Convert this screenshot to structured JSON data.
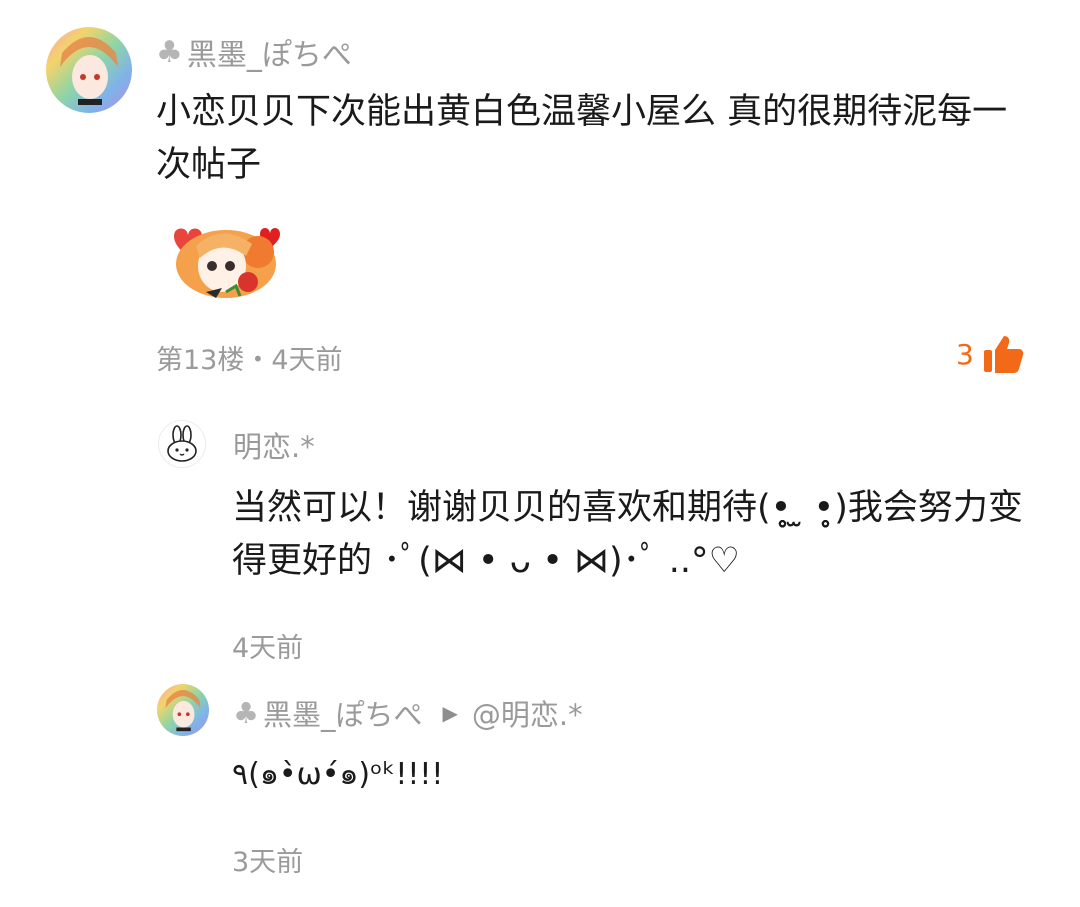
{
  "accent_color": "#f26a17",
  "comments": [
    {
      "username": "黑墨_ぽちぺ",
      "username_icon": "club-icon",
      "content": "小恋贝贝下次能出黄白色温馨小屋么 真的很期待泥每一次帖子",
      "sticker": "girl-with-rose-sticker",
      "meta": "第13楼・4天前",
      "likes": "3",
      "like_icon": "thumbs-up-icon"
    },
    {
      "username": "明恋.*",
      "content": "当然可以！谢谢贝贝的喜欢和期待(•̥̥̥ ̫ •̥̥̥)我会努力变得更好的 ･ﾟ(⋈ • ᴗ • ⋈)･ﾟ ..°♡",
      "meta": "4天前"
    },
    {
      "username": "黑墨_ぽちぺ",
      "username_icon": "club-icon",
      "reply_target": "@明恋.*",
      "content": "٩(๑•̀ω•́๑)ᵒᵏ!!!!",
      "meta": "3天前"
    }
  ]
}
